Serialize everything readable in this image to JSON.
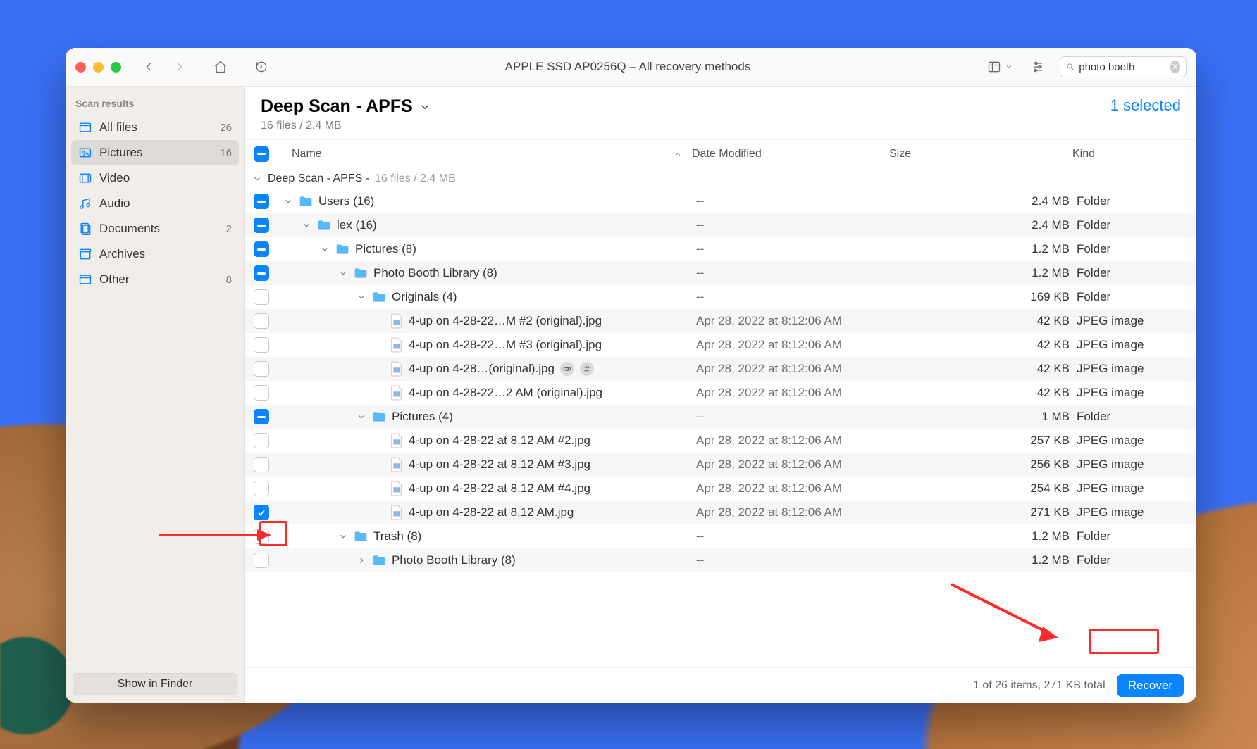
{
  "window": {
    "title": "APPLE SSD AP0256Q – All recovery methods",
    "search_value": "photo booth"
  },
  "sidebar": {
    "header": "Scan results",
    "items": [
      {
        "label": "All files",
        "count": "26"
      },
      {
        "label": "Pictures",
        "count": "16"
      },
      {
        "label": "Video",
        "count": ""
      },
      {
        "label": "Audio",
        "count": ""
      },
      {
        "label": "Documents",
        "count": "2"
      },
      {
        "label": "Archives",
        "count": ""
      },
      {
        "label": "Other",
        "count": "8"
      }
    ],
    "footer_button": "Show in Finder"
  },
  "header": {
    "title": "Deep Scan - APFS",
    "subtitle": "16 files / 2.4 MB",
    "selected_text": "1 selected"
  },
  "columns": {
    "name": "Name",
    "date": "Date Modified",
    "size": "Size",
    "kind": "Kind"
  },
  "group": {
    "label": "Deep Scan - APFS - ",
    "meta": "16 files / 2.4 MB"
  },
  "rows": [
    {
      "check": "indet",
      "indent": 0,
      "chevron": "down",
      "icon": "folder",
      "name": "Users (16)",
      "date": "--",
      "size": "2.4 MB",
      "kind": "Folder",
      "alt": false
    },
    {
      "check": "indet",
      "indent": 1,
      "chevron": "down",
      "icon": "folder",
      "name": "lex (16)",
      "date": "--",
      "size": "2.4 MB",
      "kind": "Folder",
      "alt": true
    },
    {
      "check": "indet",
      "indent": 2,
      "chevron": "down",
      "icon": "folder",
      "name": "Pictures (8)",
      "date": "--",
      "size": "1.2 MB",
      "kind": "Folder",
      "alt": false
    },
    {
      "check": "indet",
      "indent": 3,
      "chevron": "down",
      "icon": "folder",
      "name": "Photo Booth Library (8)",
      "date": "--",
      "size": "1.2 MB",
      "kind": "Folder",
      "alt": true
    },
    {
      "check": "none",
      "indent": 4,
      "chevron": "down",
      "icon": "folder",
      "name": "Originals (4)",
      "date": "--",
      "size": "169 KB",
      "kind": "Folder",
      "alt": false
    },
    {
      "check": "none",
      "indent": 5,
      "chevron": "",
      "icon": "file",
      "name": "4-up on 4-28-22…M #2 (original).jpg",
      "date": "Apr 28, 2022 at 8:12:06 AM",
      "size": "42 KB",
      "kind": "JPEG image",
      "alt": true
    },
    {
      "check": "none",
      "indent": 5,
      "chevron": "",
      "icon": "file",
      "name": "4-up on 4-28-22…M #3 (original).jpg",
      "date": "Apr 28, 2022 at 8:12:06 AM",
      "size": "42 KB",
      "kind": "JPEG image",
      "alt": false
    },
    {
      "check": "none",
      "indent": 5,
      "chevron": "",
      "icon": "file",
      "name": "4-up on 4-28…(original).jpg",
      "date": "Apr 28, 2022 at 8:12:06 AM",
      "size": "42 KB",
      "kind": "JPEG image",
      "alt": true,
      "badges": true
    },
    {
      "check": "none",
      "indent": 5,
      "chevron": "",
      "icon": "file",
      "name": "4-up on 4-28-22…2 AM (original).jpg",
      "date": "Apr 28, 2022 at 8:12:06 AM",
      "size": "42 KB",
      "kind": "JPEG image",
      "alt": false
    },
    {
      "check": "indet",
      "indent": 4,
      "chevron": "down",
      "icon": "folder",
      "name": "Pictures (4)",
      "date": "--",
      "size": "1 MB",
      "kind": "Folder",
      "alt": true
    },
    {
      "check": "none",
      "indent": 5,
      "chevron": "",
      "icon": "file",
      "name": "4-up on 4-28-22 at 8.12 AM #2.jpg",
      "date": "Apr 28, 2022 at 8:12:06 AM",
      "size": "257 KB",
      "kind": "JPEG image",
      "alt": false
    },
    {
      "check": "none",
      "indent": 5,
      "chevron": "",
      "icon": "file",
      "name": "4-up on 4-28-22 at 8.12 AM #3.jpg",
      "date": "Apr 28, 2022 at 8:12:06 AM",
      "size": "256 KB",
      "kind": "JPEG image",
      "alt": true
    },
    {
      "check": "none",
      "indent": 5,
      "chevron": "",
      "icon": "file",
      "name": "4-up on 4-28-22 at 8.12 AM #4.jpg",
      "date": "Apr 28, 2022 at 8:12:06 AM",
      "size": "254 KB",
      "kind": "JPEG image",
      "alt": false
    },
    {
      "check": "checked",
      "indent": 5,
      "chevron": "",
      "icon": "file",
      "name": "4-up on 4-28-22 at 8.12 AM.jpg",
      "date": "Apr 28, 2022 at 8:12:06 AM",
      "size": "271 KB",
      "kind": "JPEG image",
      "alt": true
    },
    {
      "check": "none",
      "indent": 3,
      "chevron": "down",
      "icon": "folder",
      "name": "Trash (8)",
      "date": "--",
      "size": "1.2 MB",
      "kind": "Folder",
      "alt": false
    },
    {
      "check": "none",
      "indent": 4,
      "chevron": "right",
      "icon": "folder",
      "name": "Photo Booth Library (8)",
      "date": "--",
      "size": "1.2 MB",
      "kind": "Folder",
      "alt": true
    }
  ],
  "status": {
    "summary": "1 of 26 items, 271 KB total",
    "button": "Recover"
  }
}
